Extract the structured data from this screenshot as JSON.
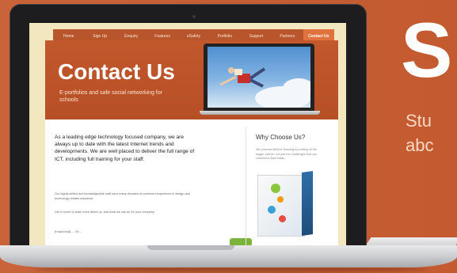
{
  "site": {
    "nav": [
      {
        "label": "Home"
      },
      {
        "label": "Sign Up"
      },
      {
        "label": "Enquiry"
      },
      {
        "label": "Features"
      },
      {
        "label": "eSafety"
      },
      {
        "label": "Portfolio"
      },
      {
        "label": "Support"
      },
      {
        "label": "Partners"
      },
      {
        "label": "Contact Us",
        "active": true
      }
    ],
    "hero": {
      "title": "Contact Us",
      "subtitle": "E-portfolios and safe social networking for schools"
    },
    "main": {
      "intro": "As a leading edge technology focused company, we are always up to date with the latest Internet trends and developments. We are well placed to deliver the full range of ICT, including full training for your staff.",
      "para1": "Our highly skilled and knowledgeable staff have many decades of combined experience in design and technology related industries.",
      "para2": "Get in touch to learn more about us, and what we can do for your company.",
      "para3": "Email info@ ... Tel ..."
    },
    "sidebar": {
      "heading": "Why Choose Us?",
      "body": "We promote lifetime learning by looking at the bigger picture, not just the challenges that our customers face today."
    }
  },
  "promo": {
    "letter": "S",
    "line1": "Stu",
    "line2": "abc"
  },
  "colors": {
    "background": "#c85f33",
    "nav_active": "#e0733d",
    "button": "#7bb33b"
  }
}
